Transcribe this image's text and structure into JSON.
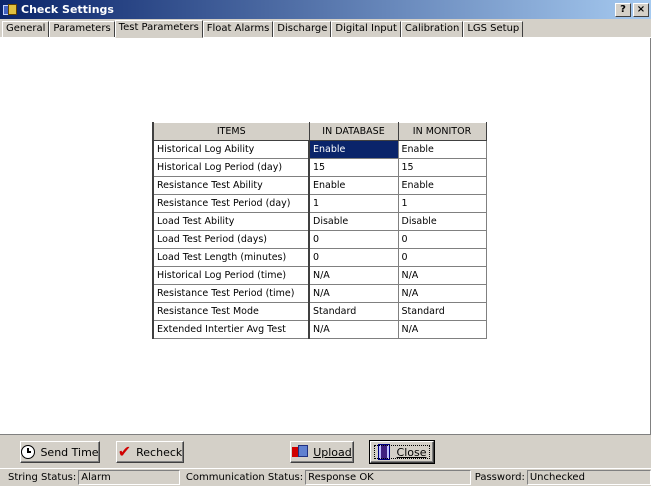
{
  "window": {
    "title": "Check Settings",
    "help_btn": "?",
    "close_btn": "×"
  },
  "tabs": [
    {
      "label": "General",
      "active": false
    },
    {
      "label": "Parameters",
      "active": false
    },
    {
      "label": "Test Parameters",
      "active": true
    },
    {
      "label": "Float Alarms",
      "active": false
    },
    {
      "label": "Discharge",
      "active": false
    },
    {
      "label": "Digital Input",
      "active": false
    },
    {
      "label": "Calibration",
      "active": false
    },
    {
      "label": "LGS Setup",
      "active": false
    }
  ],
  "grid": {
    "headers": [
      "ITEMS",
      "IN DATABASE",
      "IN MONITOR"
    ],
    "rows": [
      [
        "Historical Log Ability",
        "Enable",
        "Enable"
      ],
      [
        "Historical Log Period (day)",
        "15",
        "15"
      ],
      [
        "Resistance Test Ability",
        "Enable",
        "Enable"
      ],
      [
        "Resistance Test Period (day)",
        "1",
        "1"
      ],
      [
        "Load Test Ability",
        "Disable",
        "Disable"
      ],
      [
        "Load Test Period (days)",
        "0",
        "0"
      ],
      [
        "Load Test Length (minutes)",
        "0",
        "0"
      ],
      [
        "Historical Log Period (time)",
        "N/A",
        "N/A"
      ],
      [
        "Resistance Test Period (time)",
        "N/A",
        "N/A"
      ],
      [
        "Resistance Test Mode",
        "Standard",
        "Standard"
      ],
      [
        "Extended Intertier Avg Test",
        "N/A",
        "N/A"
      ]
    ]
  },
  "buttons": {
    "send_time": "Send Time",
    "recheck": "Recheck",
    "upload": "Upload",
    "close": "Close"
  },
  "status": {
    "string_label": "String Status:",
    "string_value": "Alarm",
    "comm_label": "Communication Status:",
    "comm_value": "Response OK",
    "password_label": "Password:",
    "password_value": "Unchecked"
  },
  "colors": {
    "title_bar": "#0a246a",
    "selection": "#0a246a",
    "face": "#d4d0c8"
  }
}
